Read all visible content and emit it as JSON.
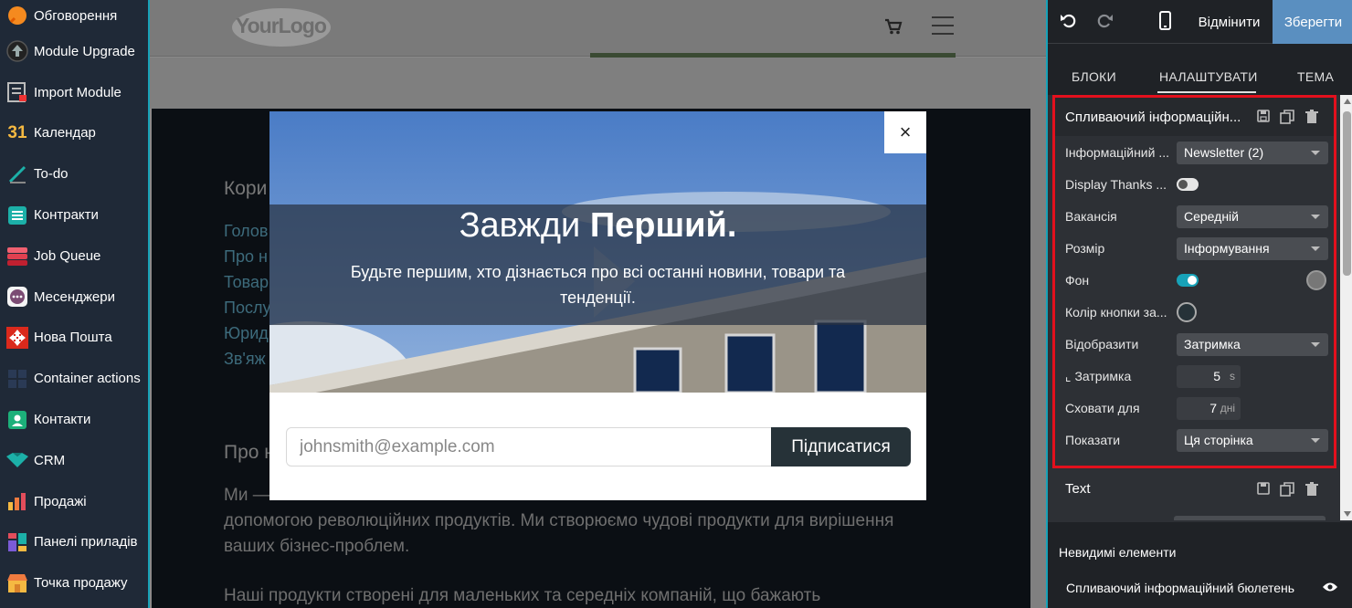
{
  "sidebar": {
    "items": [
      {
        "label": "Обговорення",
        "icon": "discuss-icon"
      },
      {
        "label": "Module Upgrade",
        "icon": "upgrade-icon"
      },
      {
        "label": "Import Module",
        "icon": "import-icon"
      },
      {
        "label": "Календар",
        "icon": "calendar-icon"
      },
      {
        "label": "To-do",
        "icon": "todo-icon"
      },
      {
        "label": "Контракти",
        "icon": "contracts-icon"
      },
      {
        "label": "Job Queue",
        "icon": "job-queue-icon"
      },
      {
        "label": "Месенджери",
        "icon": "messengers-icon"
      },
      {
        "label": "Нова Пошта",
        "icon": "nova-poshta-icon"
      },
      {
        "label": "Container actions",
        "icon": "container-icon"
      },
      {
        "label": "Контакти",
        "icon": "contacts-icon"
      },
      {
        "label": "CRM",
        "icon": "crm-icon"
      },
      {
        "label": "Продажі",
        "icon": "sales-icon"
      },
      {
        "label": "Панелі приладів",
        "icon": "dashboards-icon"
      },
      {
        "label": "Точка продажу",
        "icon": "pos-icon"
      }
    ],
    "calendar_icon_text": "31"
  },
  "site": {
    "logo_text": "YourLogo",
    "background": {
      "heading_1": "Кори",
      "links": [
        "Голов",
        "Про н",
        "Товар",
        "Послу",
        "Юрид",
        "Зв'яж"
      ],
      "heading_2": "Про н",
      "para_1_line_1": "Ми — …",
      "para_1_line_2": "допомогою революційних продуктів. Ми створюємо чудові продукти для вирішення",
      "para_1_line_3": "ваших бізнес-проблем.",
      "para_2_line_1": "Наші продукти створені для маленьких та середніх компаній, що бажають"
    }
  },
  "popup": {
    "title_regular": "Завжди ",
    "title_bold": "Перший.",
    "subtitle": "Будьте першим, хто дізнається про всі останні новини, товари та тенденції.",
    "close_label": "×",
    "email_placeholder": "johnsmith@example.com",
    "subscribe_label": "Підписатися"
  },
  "editor": {
    "discard_label": "Відмінити",
    "save_label": "Зберегти",
    "tabs": [
      "БЛОКИ",
      "НАЛАШТУВАТИ",
      "ТЕМА"
    ],
    "active_tab": "НАЛАШТУВАТИ",
    "block_title": "Спливаючий інформаційн...",
    "options": [
      {
        "label": "Інформаційний ...",
        "type": "select",
        "value": "Newsletter (2)"
      },
      {
        "label": "Display Thanks ...",
        "type": "toggle",
        "value": "off"
      },
      {
        "label": "Вакансія",
        "type": "select",
        "value": "Середній"
      },
      {
        "label": "Розмір",
        "type": "select",
        "value": "Інформування"
      },
      {
        "label": "Фон",
        "type": "toggle",
        "value": "on"
      },
      {
        "label": "Колір кнопки за...",
        "type": "color"
      },
      {
        "label": "Відобразити",
        "type": "select",
        "value": "Затримка"
      },
      {
        "label": "⌞ Затримка",
        "type": "number",
        "value": "5",
        "unit": "s"
      },
      {
        "label": "Сховати для",
        "type": "number",
        "value": "7",
        "unit": "дні"
      },
      {
        "label": "Показати",
        "type": "select",
        "value": "Ця сторінка"
      }
    ],
    "text_block_label": "Text",
    "invisible_title": "Невидимі елементи",
    "invisible_item": "Спливаючий інформаційний бюлетень"
  },
  "colors": {
    "accent": "#17a2b8",
    "save_button": "#5a8fc0",
    "highlight_border": "#e3101d",
    "subscribe_button": "#263238"
  }
}
